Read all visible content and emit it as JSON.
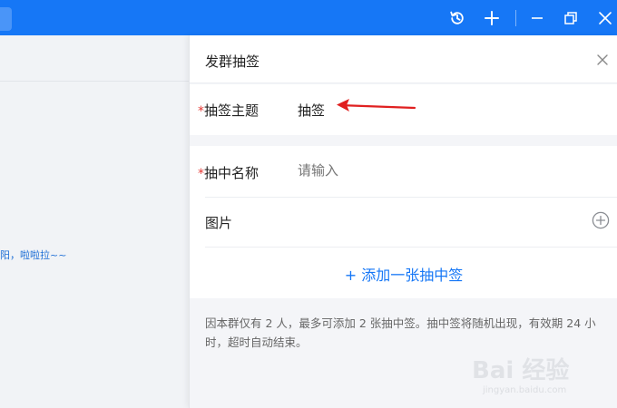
{
  "titlebar": {
    "icons": [
      "history-icon",
      "add-icon",
      "minimize-icon",
      "restore-icon",
      "close-icon"
    ]
  },
  "chat": {
    "snippet": "阳，啦啦拉~~"
  },
  "panel": {
    "title": "发群抽签",
    "topic": {
      "required_mark": "*",
      "label": "抽签主题",
      "value": "抽签"
    },
    "name_field": {
      "required_mark": "*",
      "label": "抽中名称",
      "placeholder": "请输入"
    },
    "image_field": {
      "label": "图片"
    },
    "add_link": "+ 添加一张抽中签",
    "note": "因本群仅有 2 人，最多可添加 2 张抽中签。抽中签将随机出现，有效期 24 小时，超时自动结束。"
  },
  "watermark": {
    "main": "Bai 经验",
    "sub": "jingyan.baidu.com"
  },
  "colors": {
    "accent": "#1677f6",
    "required": "#e53935",
    "annotation_arrow": "#e02020"
  }
}
